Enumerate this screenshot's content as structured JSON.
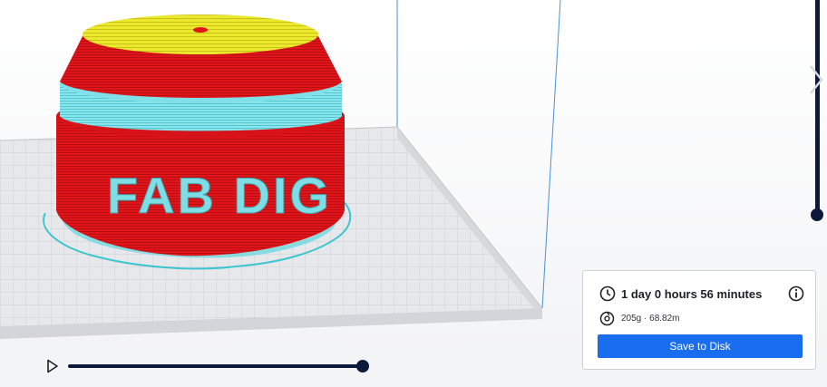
{
  "model": {
    "label": "FAB DIG"
  },
  "colors": {
    "shell_red": "#e1141a",
    "top_yellow": "#e8e427",
    "infill_cyan": "#74dfe6",
    "grid_line": "#cdd0d5",
    "plate": "#e9eaec",
    "accent_blue": "#196ef0",
    "slider_navy": "#0b1a3a"
  },
  "print_info": {
    "time": "1 day 0 hours 56 minutes",
    "material": "205g · 68.82m",
    "save_label": "Save to Disk"
  },
  "simulation": {
    "progress": 1.0
  },
  "layer_slider": {
    "position": 1.0
  },
  "icons": {
    "time": "clock-icon",
    "info": "info-icon",
    "material": "spool-icon",
    "play": "play-icon",
    "next": "chevron-right-icon"
  }
}
